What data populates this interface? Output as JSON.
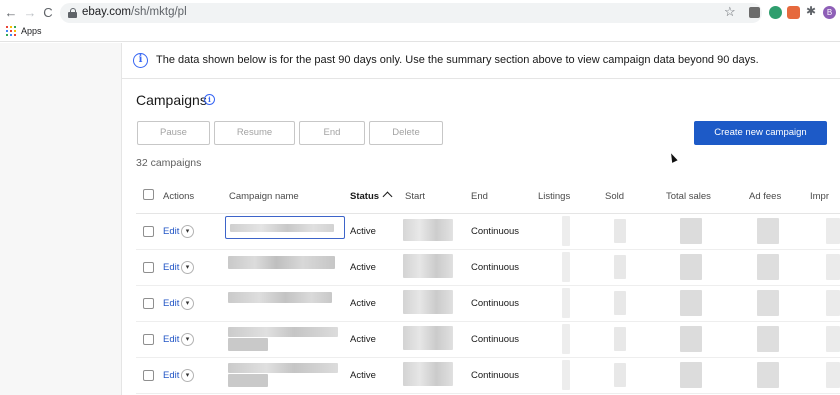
{
  "browser": {
    "nav": {
      "back": "←",
      "forward": "→",
      "reload": "C"
    },
    "url_host": "ebay.com",
    "url_path": "/sh/mktg/pl",
    "bookmark_icon": "star-icon",
    "profile_initial": "B",
    "bookmarks_bar": {
      "apps_label": "Apps"
    }
  },
  "info_banner": {
    "icon": "info-icon",
    "text": "The data shown below is for the past 90 days only. Use the summary section above to view campaign data beyond 90 days."
  },
  "campaigns": {
    "title": "Campaigns",
    "title_info_glyph": "i",
    "info_glyph": "i",
    "actions": [
      "Pause",
      "Resume",
      "End",
      "Delete"
    ],
    "create_label": "Create new campaign",
    "count_text": "32 campaigns"
  },
  "table": {
    "headers": {
      "actions": "Actions",
      "campaign_name": "Campaign name",
      "status": "Status",
      "start": "Start",
      "end": "End",
      "listings": "Listings",
      "sold": "Sold",
      "total_sales": "Total sales",
      "ad_fees": "Ad fees",
      "impressions": "Impr"
    },
    "sort": {
      "column": "status",
      "direction": "ascending"
    },
    "rows": [
      {
        "edit": "Edit",
        "status": "Active",
        "end": "Continuous"
      },
      {
        "edit": "Edit",
        "status": "Active",
        "end": "Continuous"
      },
      {
        "edit": "Edit",
        "status": "Active",
        "end": "Continuous"
      },
      {
        "edit": "Edit",
        "status": "Active",
        "end": "Continuous"
      },
      {
        "edit": "Edit",
        "status": "Active",
        "end": "Continuous"
      }
    ]
  },
  "colors": {
    "primary": "#1d5ac7",
    "link": "#2155c5",
    "info": "#3665f3"
  }
}
